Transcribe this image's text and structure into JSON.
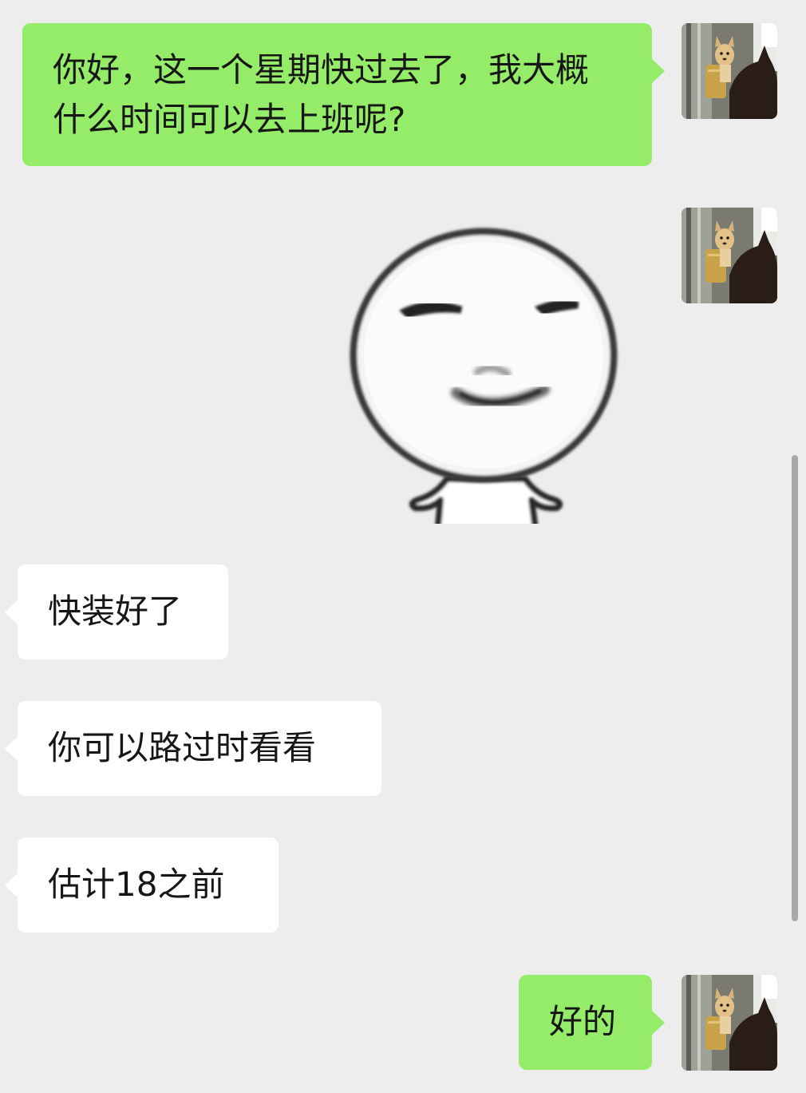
{
  "chat": {
    "messages": [
      {
        "sender": "me",
        "type": "text",
        "text": "你好，这一个星期快过去了，我大概什么时间可以去上班呢?"
      },
      {
        "sender": "me",
        "type": "sticker",
        "sticker": "smirking-face-sticker"
      },
      {
        "sender": "them",
        "type": "text",
        "text": "快装好了"
      },
      {
        "sender": "them",
        "type": "text",
        "text": "你可以路过时看看"
      },
      {
        "sender": "them",
        "type": "text",
        "text": "估计18之前"
      },
      {
        "sender": "me",
        "type": "text",
        "text": "好的"
      }
    ]
  },
  "colors": {
    "background": "#ededed",
    "my_bubble": "#95ec69",
    "their_bubble": "#ffffff",
    "text": "#161616"
  }
}
